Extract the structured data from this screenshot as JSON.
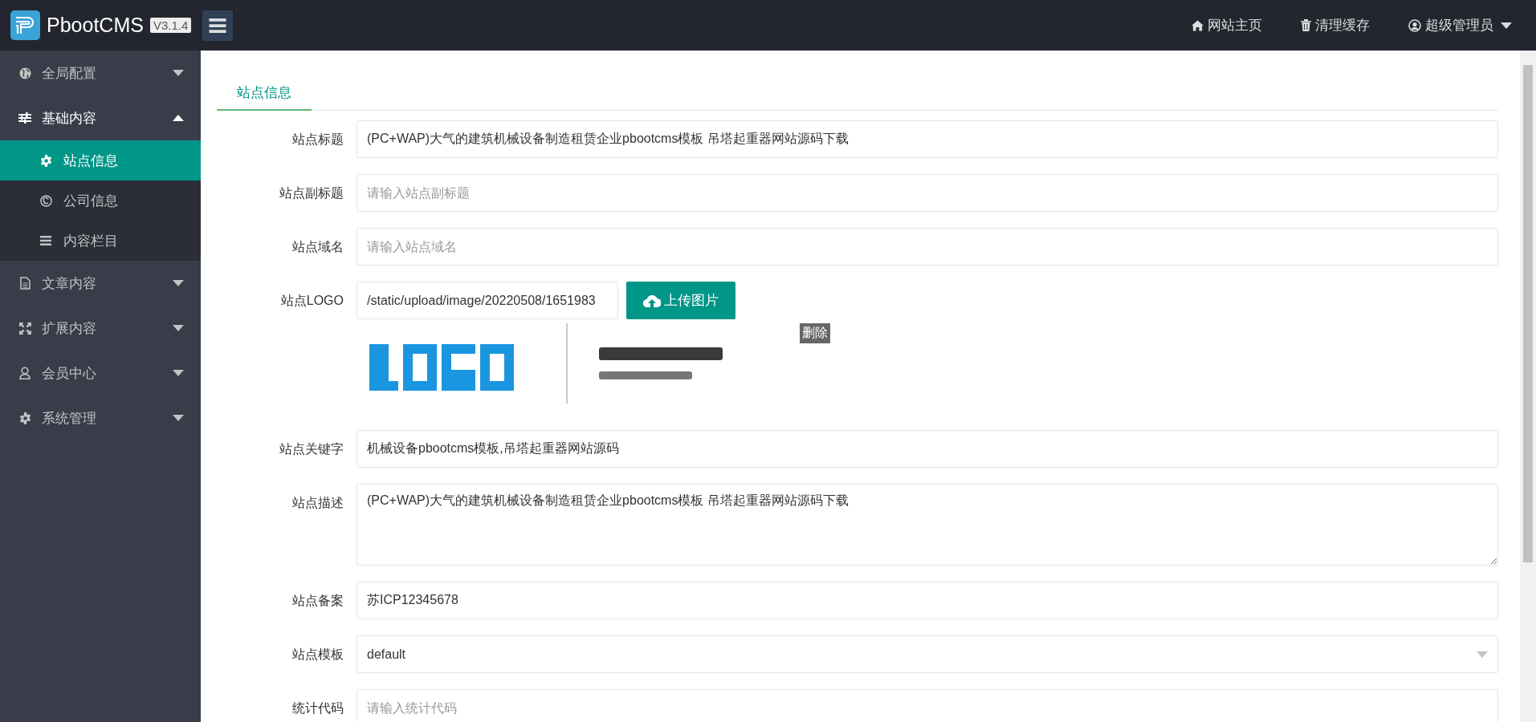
{
  "brand": {
    "name": "PbootCMS",
    "version": "V3.1.4"
  },
  "topbar": {
    "links": [
      {
        "label": "网站主页"
      },
      {
        "label": "清理缓存"
      }
    ],
    "user": {
      "label": "超级管理员"
    }
  },
  "sidebar": {
    "items": [
      {
        "label": "全局配置",
        "expanded": false
      },
      {
        "label": "基础内容",
        "expanded": true,
        "children": [
          {
            "label": "站点信息",
            "selected": true
          },
          {
            "label": "公司信息",
            "selected": false
          },
          {
            "label": "内容栏目",
            "selected": false
          }
        ]
      },
      {
        "label": "文章内容",
        "expanded": false
      },
      {
        "label": "扩展内容",
        "expanded": false
      },
      {
        "label": "会员中心",
        "expanded": false
      },
      {
        "label": "系统管理",
        "expanded": false
      }
    ]
  },
  "tabs": [
    {
      "label": "站点信息",
      "selected": true
    }
  ],
  "form": {
    "fields": [
      {
        "kind": "text",
        "label": "站点标题",
        "value": "(PC+WAP)大气的建筑机械设备制造租赁企业pbootcms模板 吊塔起重器网站源码下载"
      },
      {
        "kind": "text",
        "label": "站点副标题",
        "placeholder": "请输入站点副标题"
      },
      {
        "kind": "text",
        "label": "站点域名",
        "placeholder": "请输入站点域名"
      },
      {
        "kind": "upload",
        "label": "站点LOGO",
        "value": "/static/upload/image/20220508/1651983",
        "button": "上传图片",
        "delete": "删除"
      },
      {
        "kind": "text",
        "label": "站点关键字",
        "value": "机械设备pbootcms模板,吊塔起重器网站源码"
      },
      {
        "kind": "textarea",
        "label": "站点描述",
        "value": "(PC+WAP)大气的建筑机械设备制造租赁企业pbootcms模板 吊塔起重器网站源码下载"
      },
      {
        "kind": "text",
        "label": "站点备案",
        "value": "苏ICP12345678"
      },
      {
        "kind": "select",
        "label": "站点模板",
        "value": "default"
      },
      {
        "kind": "text",
        "label": "统计代码",
        "placeholder": "请输入统计代码"
      }
    ]
  }
}
